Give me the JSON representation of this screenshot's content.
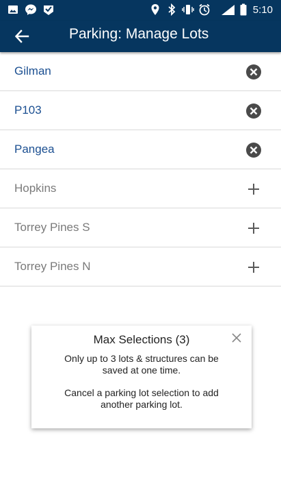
{
  "status_bar": {
    "time": "5:10",
    "network": "LTE",
    "left_icons": [
      "image-icon",
      "messenger-icon",
      "check-notification-icon"
    ],
    "right_icons": [
      "location-icon",
      "bluetooth-icon",
      "vibrate-icon",
      "alarm-icon",
      "lte-signal-icon",
      "battery-icon"
    ]
  },
  "app_bar": {
    "title": "Parking: Manage Lots",
    "back_icon": "arrow-back-icon",
    "background": "#06365f"
  },
  "lots": [
    {
      "label": "Gilman",
      "state": "selected",
      "action_icon": "remove-circle-icon"
    },
    {
      "label": "P103",
      "state": "selected",
      "action_icon": "remove-circle-icon"
    },
    {
      "label": "Pangea",
      "state": "selected",
      "action_icon": "remove-circle-icon"
    },
    {
      "label": "Hopkins",
      "state": "available",
      "action_icon": "plus-icon"
    },
    {
      "label": "Torrey Pines S",
      "state": "available",
      "action_icon": "plus-icon"
    },
    {
      "label": "Torrey Pines N",
      "state": "available",
      "action_icon": "plus-icon"
    }
  ],
  "modal": {
    "title": "Max Selections (3)",
    "line1": "Only up to 3 lots & structures can be saved at one time.",
    "line2": "Cancel a parking lot selection to add another parking lot.",
    "close_icon": "close-icon"
  },
  "colors": {
    "selected_text": "#1b4f91",
    "available_text": "#7a7a7a"
  }
}
